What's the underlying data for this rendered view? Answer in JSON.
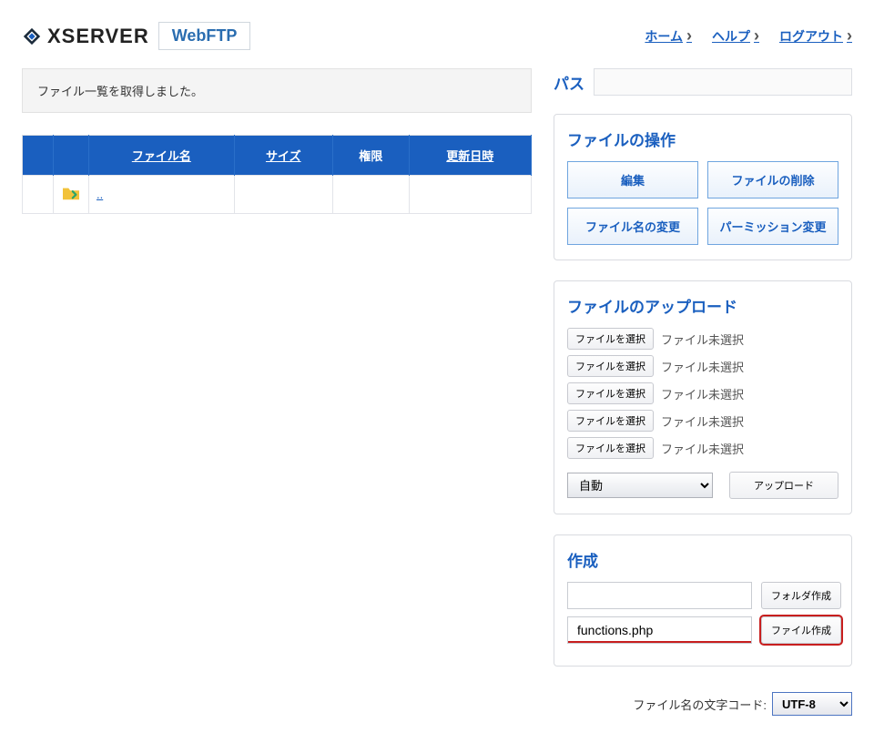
{
  "header": {
    "brand": "XSERVER",
    "badge": "WebFTP",
    "nav": {
      "home": "ホーム",
      "help": "ヘルプ",
      "logout": "ログアウト"
    }
  },
  "status_message": "ファイル一覧を取得しました。",
  "file_table": {
    "columns": {
      "name": "ファイル名",
      "size": "サイズ",
      "perm": "権限",
      "updated": "更新日時"
    },
    "rows": [
      {
        "link": ".."
      }
    ]
  },
  "path": {
    "label": "パス",
    "value": ""
  },
  "operations": {
    "title": "ファイルの操作",
    "edit": "編集",
    "delete": "ファイルの削除",
    "rename": "ファイル名の変更",
    "perm": "パーミッション変更"
  },
  "upload": {
    "title": "ファイルのアップロード",
    "choose_label": "ファイルを選択",
    "no_file": "ファイル未選択",
    "mode_option": "自動",
    "upload_btn": "アップロード"
  },
  "create": {
    "title": "作成",
    "folder_input": "",
    "folder_btn": "フォルダ作成",
    "file_input": "functions.php",
    "file_btn": "ファイル作成"
  },
  "encoding": {
    "label": "ファイル名の文字コード:",
    "value": "UTF-8"
  }
}
